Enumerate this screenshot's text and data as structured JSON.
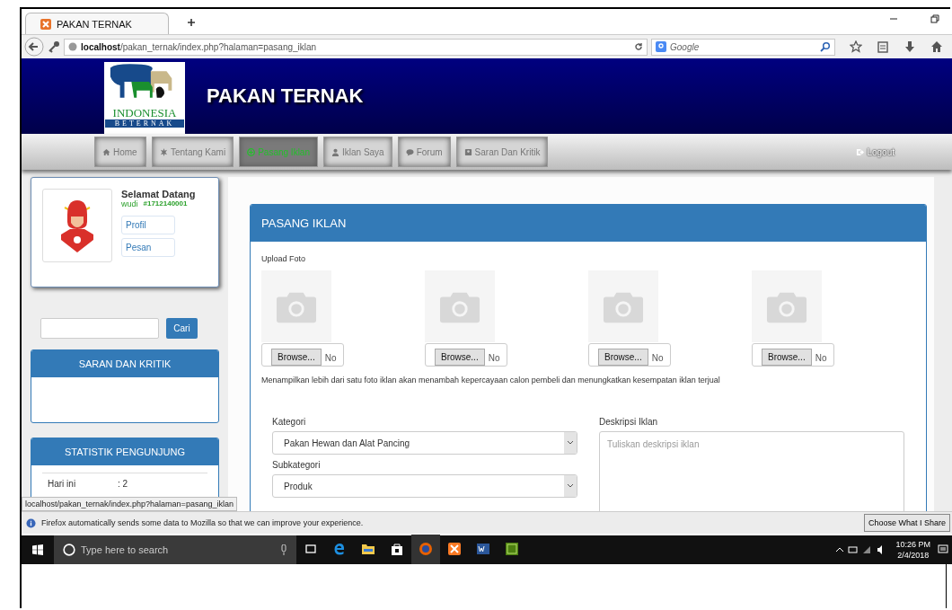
{
  "browser": {
    "tab_title": "PAKAN TERNAK",
    "url_host": "localhost",
    "url_path": "/pakan_ternak/index.php?halaman=pasang_iklan",
    "search_placeholder": "Google"
  },
  "header": {
    "logo_text": "INDONESIA",
    "logo_subtext": "BETERNAK",
    "title": "PAKAN TERNAK"
  },
  "nav": {
    "items": [
      {
        "label": "Home",
        "selected": false
      },
      {
        "label": "Tentang Kami",
        "selected": false
      },
      {
        "label": "Pasang Iklan",
        "selected": true
      },
      {
        "label": "Iklan Saya",
        "selected": false
      },
      {
        "label": "Forum",
        "selected": false
      },
      {
        "label": "Saran Dan Kritik",
        "selected": false
      }
    ],
    "logout": "Logout"
  },
  "profile": {
    "greeting": "Selamat Datang",
    "username": "wudi",
    "user_id": "#1712140001",
    "links": [
      "Profil",
      "Pesan"
    ]
  },
  "search": {
    "button": "Cari"
  },
  "widgets": [
    {
      "title": "SARAN DAN KRITIK"
    },
    {
      "title": "STATISTIK PENGUNJUNG",
      "rows": [
        {
          "label": "Hari ini",
          "value": ": 2"
        }
      ]
    }
  ],
  "form": {
    "title": "PASANG IKLAN",
    "upload_label": "Upload Foto",
    "uploads": [
      {
        "button": "Browse...",
        "status": "No"
      },
      {
        "button": "Browse...",
        "status": "No"
      },
      {
        "button": "Browse...",
        "status": "No"
      },
      {
        "button": "Browse...",
        "status": "No"
      }
    ],
    "note": "Menampilkan lebih dari satu foto iklan akan menambah kepercayaan calon pembeli dan menungkatkan kesempatan iklan terjual",
    "selects": [
      {
        "label": "Kategori",
        "value": "Pakan Hewan dan Alat Pancing"
      },
      {
        "label": "Subkategori",
        "value": "Produk"
      }
    ],
    "description": {
      "label": "Deskripsi Iklan",
      "placeholder": "Tuliskan deskripsi iklan"
    }
  },
  "status_url": "localhost/pakan_ternak/index.php?halaman=pasang_iklan",
  "notification": {
    "text": "Firefox automatically sends some data to Mozilla so that we can improve your experience.",
    "button": "Choose What I Share"
  },
  "taskbar": {
    "search_placeholder": "Type here to search",
    "time": "10:26 PM",
    "date": "2/4/2018"
  }
}
